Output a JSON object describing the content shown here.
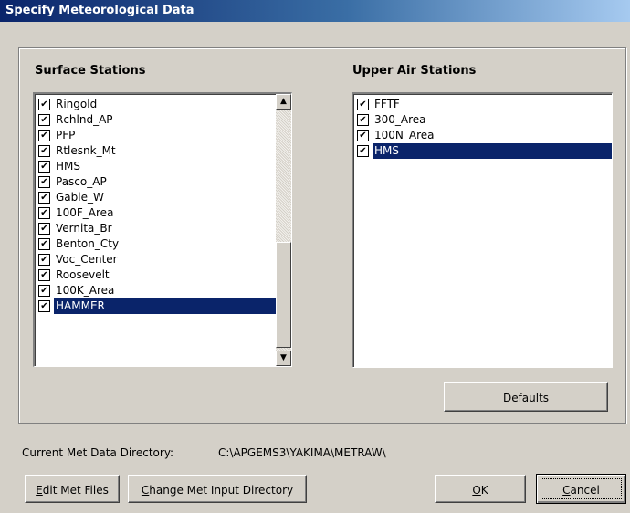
{
  "window": {
    "title": "Specify Meteorological Data"
  },
  "surface": {
    "heading": "Surface Stations",
    "items": [
      {
        "label": "Ringold",
        "checked": true
      },
      {
        "label": "Rchlnd_AP",
        "checked": true
      },
      {
        "label": "PFP",
        "checked": true
      },
      {
        "label": "Rtlesnk_Mt",
        "checked": true
      },
      {
        "label": "HMS",
        "checked": true
      },
      {
        "label": "Pasco_AP",
        "checked": true
      },
      {
        "label": "Gable_W",
        "checked": true
      },
      {
        "label": "100F_Area",
        "checked": true
      },
      {
        "label": "Vernita_Br",
        "checked": true
      },
      {
        "label": "Benton_Cty",
        "checked": true
      },
      {
        "label": "Voc_Center",
        "checked": true
      },
      {
        "label": "Roosevelt",
        "checked": true
      },
      {
        "label": "100K_Area",
        "checked": true
      },
      {
        "label": "HAMMER",
        "checked": true,
        "selected": true
      }
    ]
  },
  "upper": {
    "heading": "Upper Air Stations",
    "items": [
      {
        "label": "FFTF",
        "checked": true
      },
      {
        "label": "300_Area",
        "checked": true
      },
      {
        "label": "100N_Area",
        "checked": true
      },
      {
        "label": "HMS",
        "checked": true,
        "selected": true
      }
    ]
  },
  "buttons": {
    "defaults": {
      "pre": "",
      "key": "D",
      "post": "efaults"
    },
    "edit": {
      "pre": "",
      "key": "E",
      "post": "dit Met Files"
    },
    "change": {
      "pre": "",
      "key": "C",
      "post": "hange Met Input Directory"
    },
    "ok": {
      "pre": "",
      "key": "O",
      "post": "K"
    },
    "cancel": {
      "pre": "",
      "key": "C",
      "post": "ancel"
    }
  },
  "directory": {
    "label": "Current Met Data Directory:",
    "value": "C:\\APGEMS3\\YAKIMA\\METRAW\\"
  },
  "colors": {
    "title_bar": "#0a246a",
    "selection": "#0a246a",
    "dialog": "#d4d0c8"
  }
}
